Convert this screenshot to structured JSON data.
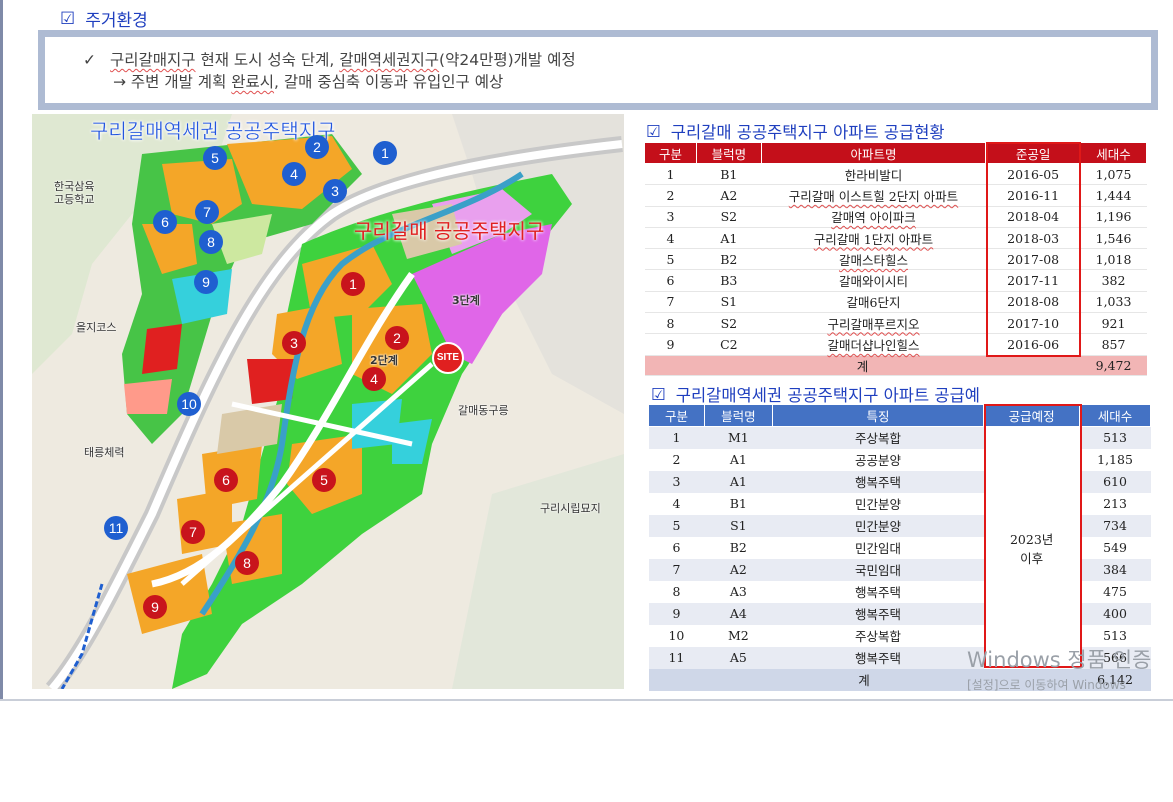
{
  "section": {
    "checkbox": "☑",
    "title": "주거환경"
  },
  "summary": {
    "check": "✓",
    "line1_a": "구리갈매지구",
    "line1_b": " 현재 도시 성숙 단계, ",
    "line1_c": "갈매역세권지구",
    "line1_d": "(약24만평)개발  예정",
    "line2_a": "→ 주변 개발 계획 ",
    "line2_b": "완료시",
    "line2_c": ", 갈매 중심축 이동과 유입인구 예상"
  },
  "map": {
    "title_station": "구리갈매역세권 공공주택지구",
    "title_galmae": "구리갈매 공공주택지구",
    "site": "SITE",
    "labels": {
      "school": "한국삼육\n고등학교",
      "euljicourse": "을지코스",
      "taereung": "태릉체력",
      "cemetery": "구리시립묘지",
      "galmaedong": "갈매동구릉",
      "phase3": "3단계",
      "phase2": "2단계"
    },
    "blue_markers": [
      "1",
      "2",
      "3",
      "4",
      "5",
      "6",
      "7",
      "8",
      "9",
      "10",
      "11"
    ],
    "red_markers": [
      "1",
      "2",
      "3",
      "4",
      "5",
      "6",
      "7",
      "8",
      "9"
    ]
  },
  "table1": {
    "checkbox": "☑",
    "title": "구리갈매 공공주택지구 아파트 공급현황",
    "headers": [
      "구분",
      "블럭명",
      "아파트명",
      "준공일",
      "세대수"
    ],
    "rows": [
      [
        "1",
        "B1",
        "한라비발디",
        "2016-05",
        "1,075"
      ],
      [
        "2",
        "A2",
        "구리갈매 이스트힐 2단지 아파트",
        "2016-11",
        "1,444"
      ],
      [
        "3",
        "S2",
        "갈매역 아이파크",
        "2018-04",
        "1,196"
      ],
      [
        "4",
        "A1",
        "구리갈매 1단지 아파트",
        "2018-03",
        "1,546"
      ],
      [
        "5",
        "B2",
        "갈매스타힐스",
        "2017-08",
        "1,018"
      ],
      [
        "6",
        "B3",
        "갈매와이시티",
        "2017-11",
        "382"
      ],
      [
        "7",
        "S1",
        "갈매6단지",
        "2018-08",
        "1,033"
      ],
      [
        "8",
        "S2",
        "구리갈매푸르지오",
        "2017-10",
        "921"
      ],
      [
        "9",
        "C2",
        "갈매더샵나인힐스",
        "2016-06",
        "857"
      ]
    ],
    "total_label": "계",
    "total_value": "9,472"
  },
  "table2": {
    "checkbox": "☑",
    "title": "구리갈매역세권  공공주택지구 아파트 공급예",
    "headers": [
      "구분",
      "블럭명",
      "특징",
      "공급예정",
      "세대수"
    ],
    "rows": [
      [
        "1",
        "M1",
        "주상복합",
        "513"
      ],
      [
        "2",
        "A1",
        "공공분양",
        "1,185"
      ],
      [
        "3",
        "A1",
        "행복주택",
        "610"
      ],
      [
        "4",
        "B1",
        "민간분양",
        "213"
      ],
      [
        "5",
        "S1",
        "민간분양",
        "734"
      ],
      [
        "6",
        "B2",
        "민간임대",
        "549"
      ],
      [
        "7",
        "A2",
        "국민임대",
        "384"
      ],
      [
        "8",
        "A3",
        "행복주택",
        "475"
      ],
      [
        "9",
        "A4",
        "행복주택",
        "400"
      ],
      [
        "10",
        "M2",
        "주상복합",
        "513"
      ],
      [
        "11",
        "A5",
        "행복주택",
        "566"
      ]
    ],
    "supply_schedule": "2023년\n이후",
    "total_label": "계",
    "total_value": "6,142"
  },
  "watermark": {
    "line1": "Windows 정품 인증",
    "line2": "[설정]으로 이동하여 Windows"
  },
  "colors": {
    "heading_blue": "#1f3fbf",
    "table1_header": "#c40f1a",
    "table1_total": "#f2b5b5",
    "table2_header": "#4472c4",
    "highlight_box": "#e01818"
  }
}
